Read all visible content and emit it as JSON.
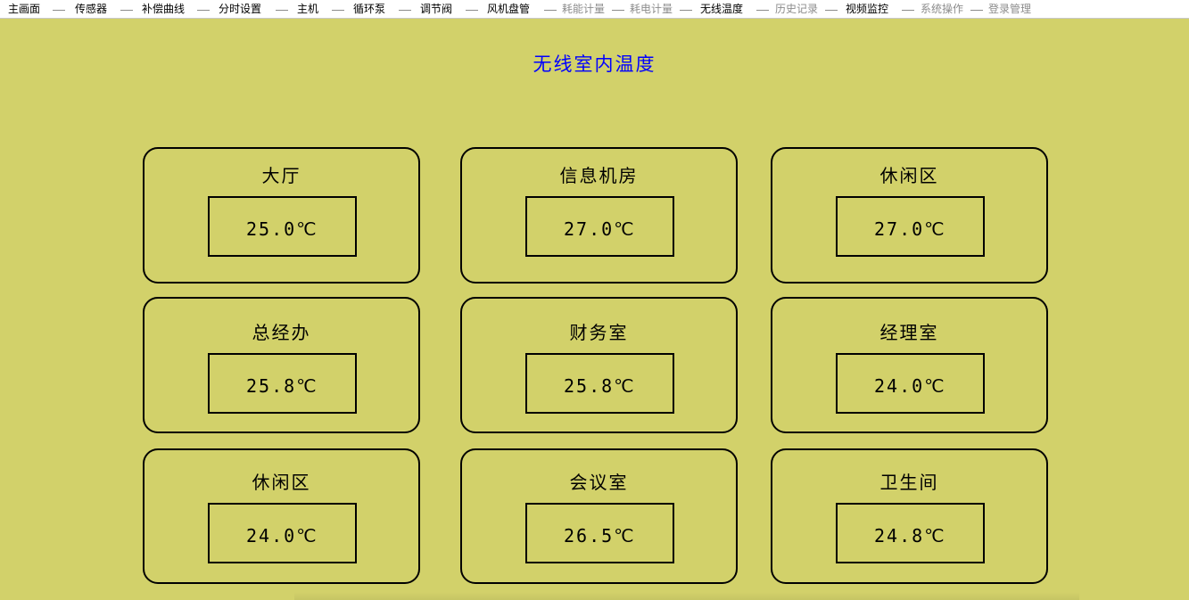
{
  "menu": [
    {
      "label": "主画面",
      "enabled": true
    },
    {
      "label": "传感器",
      "enabled": true
    },
    {
      "label": "补偿曲线",
      "enabled": true
    },
    {
      "label": "分时设置",
      "enabled": true
    },
    {
      "label": "主机",
      "enabled": true
    },
    {
      "label": "循环泵",
      "enabled": true
    },
    {
      "label": "调节阀",
      "enabled": true
    },
    {
      "label": "风机盘管",
      "enabled": true
    },
    {
      "label": "耗能计量",
      "enabled": false
    },
    {
      "label": "耗电计量",
      "enabled": false
    },
    {
      "label": "无线温度",
      "enabled": true
    },
    {
      "label": "历史记录",
      "enabled": false
    },
    {
      "label": "视频监控",
      "enabled": true
    },
    {
      "label": "系统操作",
      "enabled": false
    },
    {
      "label": "登录管理",
      "enabled": false
    }
  ],
  "page_title": "无线室内温度",
  "rooms": [
    {
      "name": "大厅",
      "temp": "25.0℃"
    },
    {
      "name": "信息机房",
      "temp": "27.0℃"
    },
    {
      "name": "休闲区",
      "temp": "27.0℃"
    },
    {
      "name": "总经办",
      "temp": "25.8℃"
    },
    {
      "name": "财务室",
      "temp": "25.8℃"
    },
    {
      "name": "经理室",
      "temp": "24.0℃"
    },
    {
      "name": "休闲区",
      "temp": "24.0℃"
    },
    {
      "name": "会议室",
      "temp": "26.5℃"
    },
    {
      "name": "卫生间",
      "temp": "24.8℃"
    }
  ]
}
